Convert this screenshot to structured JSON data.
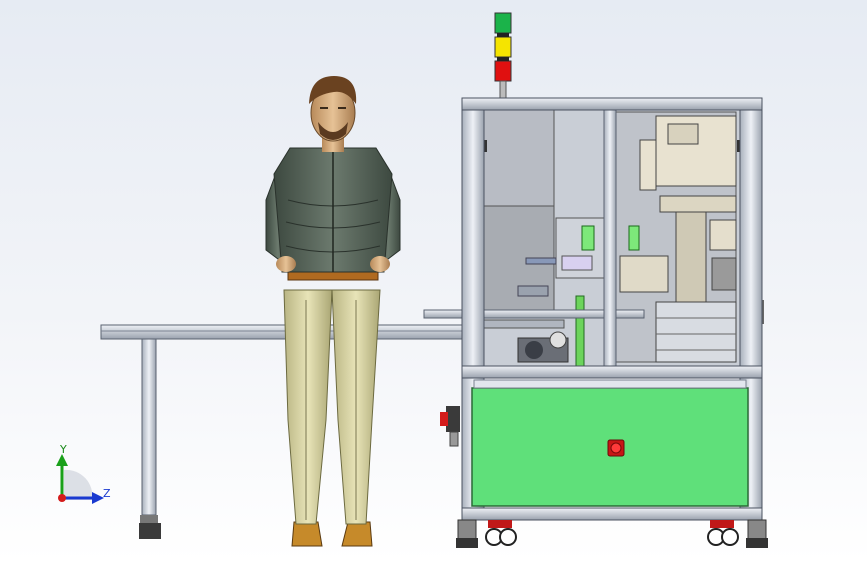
{
  "scene": {
    "colors": {
      "background_top": "#e6ebf3",
      "machine_frame": "#d8dde6",
      "machine_panel": "#5fe07a",
      "stack_green": "#1bb34a",
      "stack_yellow": "#f5e400",
      "stack_red": "#e01010",
      "emergency_stop": "#d41b1b",
      "operator_jacket": "#4e5a50",
      "operator_trousers": "#d6d2a0"
    },
    "icons": [
      "stack-light-icon",
      "emergency-stop-icon",
      "caster-wheel-icon",
      "coordinate-axes-icon"
    ]
  },
  "triad": {
    "y_label": "Y",
    "z_label": "Z"
  }
}
